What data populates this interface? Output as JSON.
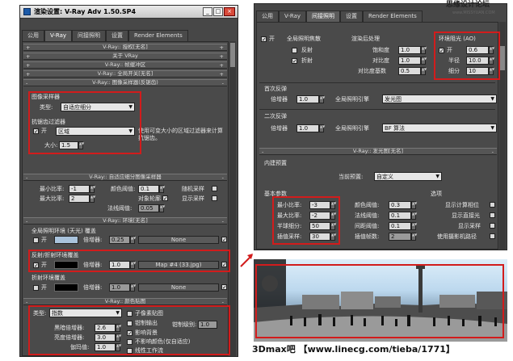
{
  "left": {
    "title": "渲染设置: V-Ray Adv 1.50.SP4",
    "window_buttons": [
      "_",
      "□",
      "×"
    ],
    "tabs": [
      "公用",
      "V-Ray",
      "间接照明",
      "设置",
      "Render Elements"
    ],
    "rollouts": [
      "V-Ray:: 授权[无名]",
      "关于 VRay",
      "V-Ray:: 帧缓冲区",
      "V-Ray:: 全局开关[无名]",
      "V-Ray:: 图像采样器(反锯齿)"
    ],
    "sampler": {
      "group": "图像采样器",
      "type_label": "类型:",
      "type_value": "自适应细分"
    },
    "aa": {
      "group": "抗锯齿过滤器",
      "on": "开",
      "filter": "区域",
      "desc": "使用可变大小的区域过滤器来计算抗锯齿。",
      "size_label": "大小:",
      "size_value": "1.5"
    },
    "subdiv": {
      "title": "V-Ray:: 自适应细分图像采样器",
      "min_rate_label": "最小比率:",
      "min_rate": "-1",
      "max_rate_label": "最大比率:",
      "max_rate": "2",
      "color_thresh_label": "颜色阈值:",
      "color_thresh": "0.1",
      "object_outline": "对象轮廓",
      "normal_thresh_label": "法线阈值:",
      "normal_thresh": "0.05",
      "random": "随机采样",
      "show_samples": "显示采样"
    },
    "env": {
      "title": "V-Ray:: 环境[无名]",
      "gi_group": "全局照明环境 (天光) 覆盖",
      "on": "开",
      "mult_label": "倍增器:",
      "mult": "0.25",
      "none1": "None",
      "refl_group": "反射/折射环境覆盖",
      "refl_mult": "1.0",
      "refl_map": "Map #4 (33.jpg)",
      "refr_group": "折射环境覆盖",
      "refr_mult": "1.0",
      "none3": "None"
    },
    "color": {
      "title": "V-Ray:: 颜色贴图",
      "type_label": "类型:",
      "type_value": "指数",
      "dark_label": "黑暗倍增器:",
      "dark": "2.6",
      "bright_label": "亮度倍增器:",
      "bright": "3.0",
      "gamma_label": "伽玛值:",
      "gamma": "1.0",
      "subpixel": "子像素贴图",
      "clamp": "钳制输出",
      "clamp_level_label": "钳制级别:",
      "clamp_level": "1.0",
      "affect_bg": "影响背景",
      "no_affect": "不影响颜色(仅自适应)",
      "linear": "线性工作流"
    }
  },
  "right": {
    "tabs": [
      "公用",
      "V-Ray",
      "间接照明",
      "设置",
      "Render Elements"
    ],
    "gi": {
      "on": "开",
      "caustics_group": "全局照明焦散",
      "reflect": "反射",
      "refract": "折射",
      "post_group": "渲染后处理",
      "sat_label": "饱和度",
      "sat": "1.0",
      "contrast_label": "对比度",
      "contrast": "1.0",
      "base_label": "对比度基数",
      "base": "0.5",
      "ao_group": "环境阻光 (AO)",
      "ao_on": "开",
      "ao_amount": "0.6",
      "radius_label": "半径",
      "radius": "10.0",
      "subdivs_label": "细分",
      "subdivs": "10"
    },
    "primary": {
      "group": "首次反弹",
      "mult_label": "倍增器",
      "mult": "1.0",
      "engine_label": "全局照明引擎",
      "engine": "发光图"
    },
    "secondary": {
      "group": "二次反弹",
      "mult_label": "倍增器",
      "mult": "1.0",
      "engine_label": "全局照明引擎",
      "engine": "BF 算法"
    },
    "irradiance": {
      "title": "V-Ray:: 发光图[无名]",
      "preset_group": "内建预置",
      "preset_label": "当前预置:",
      "preset": "自定义",
      "basic_group": "基本参数",
      "min_label": "最小比率:",
      "min": "-3",
      "max_label": "最大比率:",
      "max": "-2",
      "hsph_label": "半球细分:",
      "hsph": "50",
      "interp_label": "插值采样:",
      "interp": "30",
      "clr_label": "颜色阈值:",
      "clr": "0.3",
      "nrm_label": "法线阈值:",
      "nrm": "0.1",
      "dist_label": "间距阈值:",
      "dist": "0.1",
      "frames_label": "插值帧数:",
      "frames": "2",
      "opts_group": "选项",
      "opt1": "显示计算相位",
      "opt2": "显示直接光",
      "opt3": "显示采样",
      "opt4": "使用摄影机路径"
    }
  },
  "watermark_top": "思缘设计论坛",
  "watermark_site": "www.MISSYUAN.COM",
  "caption": "3Dmax吧 【www.linecg.com/tieba/1771】"
}
